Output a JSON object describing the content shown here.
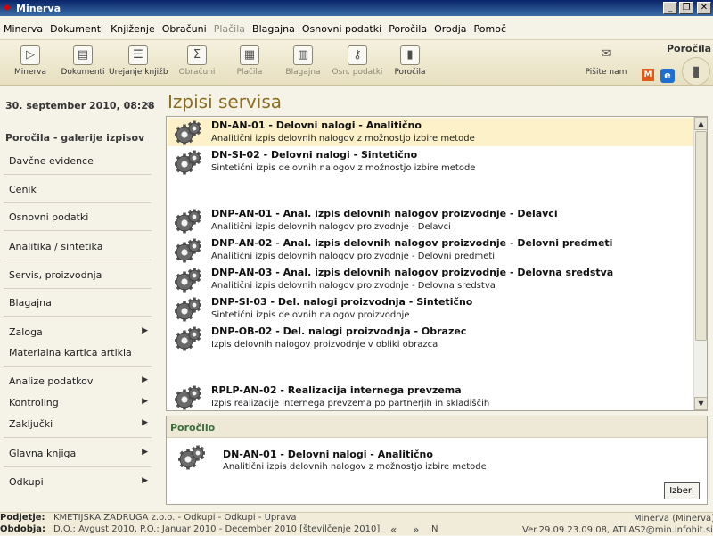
{
  "window": {
    "title": "Minerva",
    "app_icon": "minerva-logo-icon"
  },
  "menu": [
    {
      "label": "Minerva",
      "enabled": true
    },
    {
      "label": "Dokumenti",
      "enabled": true
    },
    {
      "label": "Knjiženje",
      "enabled": true
    },
    {
      "label": "Obračuni",
      "enabled": true
    },
    {
      "label": "Plačila",
      "enabled": false
    },
    {
      "label": "Blagajna",
      "enabled": true
    },
    {
      "label": "Osnovni podatki",
      "enabled": true
    },
    {
      "label": "Poročila",
      "enabled": true
    },
    {
      "label": "Orodja",
      "enabled": true
    },
    {
      "label": "Pomoč",
      "enabled": true
    }
  ],
  "toolbar": {
    "buttons": [
      {
        "label": "Minerva",
        "icon": "play-icon",
        "glyph": "▷",
        "enabled": true
      },
      {
        "label": "Dokumenti",
        "icon": "document-icon",
        "glyph": "▤",
        "enabled": true
      },
      {
        "label": "Urejanje knjižb",
        "icon": "book-icon",
        "glyph": "☰",
        "enabled": true
      },
      {
        "label": "Obračuni",
        "icon": "calculator-icon",
        "glyph": "Σ",
        "enabled": false
      },
      {
        "label": "Plačila",
        "icon": "payment-icon",
        "glyph": "▦",
        "enabled": false
      },
      {
        "label": "Blagajna",
        "icon": "cash-register-icon",
        "glyph": "▥",
        "enabled": false
      },
      {
        "label": "Osn. podatki",
        "icon": "key-icon",
        "glyph": "⚷",
        "enabled": false
      },
      {
        "label": "Poročila",
        "icon": "bar-chart-icon",
        "glyph": "▮",
        "enabled": true
      }
    ],
    "right": {
      "label": "Pišite nam",
      "icon": "envelope-icon",
      "glyph": "✉"
    },
    "section_label": "Poročila"
  },
  "left": {
    "datetime": "30. september 2010, 08:28",
    "collapse": "«",
    "gallery_title": "Poročila - galerije izpisov",
    "items": [
      {
        "label": "Davčne evidence",
        "arrow": ""
      },
      {
        "label": "Cenik",
        "arrow": ""
      },
      {
        "label": "Osnovni podatki",
        "arrow": ""
      },
      {
        "label": "Analitika / sintetika",
        "arrow": ""
      },
      {
        "label": "Servis, proizvodnja",
        "arrow": ""
      },
      {
        "label": "Blagajna",
        "arrow": ""
      },
      {
        "label": "Zaloga",
        "arrow": "▶"
      },
      {
        "label": "Materialna kartica artikla",
        "arrow": ""
      },
      {
        "label": "Analize podatkov",
        "arrow": "▶"
      },
      {
        "label": "Kontroling",
        "arrow": "▶"
      },
      {
        "label": "Zaključki",
        "arrow": "▶"
      },
      {
        "label": "Glavna knjiga",
        "arrow": "▶"
      },
      {
        "label": "Odkupi",
        "arrow": "▶"
      }
    ]
  },
  "main": {
    "title": "Izpisi servisa",
    "reports": [
      {
        "code": "DN-AN-01 - Delovni nalogi - Analitično",
        "desc": "Analitični izpis delovnih nalogov z možnostjo izbire metode",
        "selected": true
      },
      {
        "code": "DN-SI-02 - Delovni nalogi - Sintetično",
        "desc": "Sintetični izpis delovnih nalogov z možnostjo izbire metode",
        "selected": false
      },
      {
        "code": "DNP-AN-01 - Anal. izpis delovnih nalogov proizvodnje - Delavci",
        "desc": "Analitični izpis delovnih nalogov proizvodnje - Delavci",
        "selected": false
      },
      {
        "code": "DNP-AN-02 - Anal. izpis delovnih nalogov proizvodnje - Delovni predmeti",
        "desc": "Analitični izpis delovnih nalogov proizvodnje - Delovni predmeti",
        "selected": false
      },
      {
        "code": "DNP-AN-03 - Anal. izpis delovnih nalogov proizvodnje - Delovna sredstva",
        "desc": "Analitični izpis delovnih nalogov proizvodnje - Delovna sredstva",
        "selected": false
      },
      {
        "code": "DNP-SI-03 - Del. nalogi proizvodnja - Sintetično",
        "desc": "Sintetični izpis delovnih nalogov proizvodnje",
        "selected": false
      },
      {
        "code": "DNP-OB-02 - Del. nalogi proizvodnja - Obrazec",
        "desc": "Izpis delovnih nalogov proizvodnje v obliki obrazca",
        "selected": false
      },
      {
        "code": "RPLP-AN-02 - Realizacija internega prevzema",
        "desc": "Izpis realizacije internega prevzema po partnerjih in skladiščih",
        "selected": false
      }
    ]
  },
  "preview": {
    "header": "Poročilo",
    "code": "DN-AN-01 - Delovni nalogi - Analitično",
    "desc": "Analitični izpis delovnih nalogov z možnostjo izbire metode",
    "button": "Izberi"
  },
  "status": {
    "company_label": "Podjetje:",
    "company_value": "KMETIJSKA ZADRUGA z.o.o. - Odkupi - Odkupi - Uprava",
    "period_label": "Obdobja:",
    "period_value": "D.O.: Avgust 2010, P.O.: Januar 2010 - December 2010 [številčenje 2010]",
    "nav_prev": "«",
    "nav_next": "»",
    "nav_n": "N",
    "user": "Minerva (Minerva)",
    "version": "Ver.29.09.23.09.08, ATLAS2@min.infohit.si"
  }
}
